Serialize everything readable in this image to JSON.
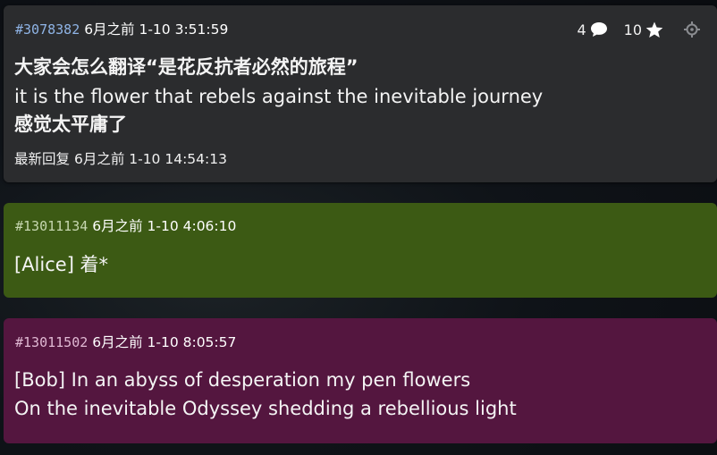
{
  "thread": {
    "id": "#3078382",
    "timestamp": "6月之前 1-10 3:51:59",
    "reply_count": "4",
    "star_count": "10",
    "lines": [
      "大家会怎么翻译“是花反抗者必然的旅程”",
      "it is the flower that rebels against the inevitable journey",
      "感觉太平庸了"
    ],
    "last_reply_label": "最新回复",
    "last_reply_time": "6月之前 1-10 14:54:13"
  },
  "replies": [
    {
      "id": "#13011134",
      "timestamp": "6月之前 1-10 4:06:10",
      "lines": [
        "[Alice] 着*"
      ],
      "color": "#3c5a14"
    },
    {
      "id": "#13011502",
      "timestamp": "6月之前 1-10 8:05:57",
      "lines": [
        "[Bob] In an abyss of desperation my pen flowers",
        "On the inevitable Odyssey shedding a rebellious light"
      ],
      "color": "#54163f"
    }
  ],
  "icons": {
    "reply": "speech-bubble-icon",
    "star": "star-icon",
    "locate": "target-icon"
  }
}
